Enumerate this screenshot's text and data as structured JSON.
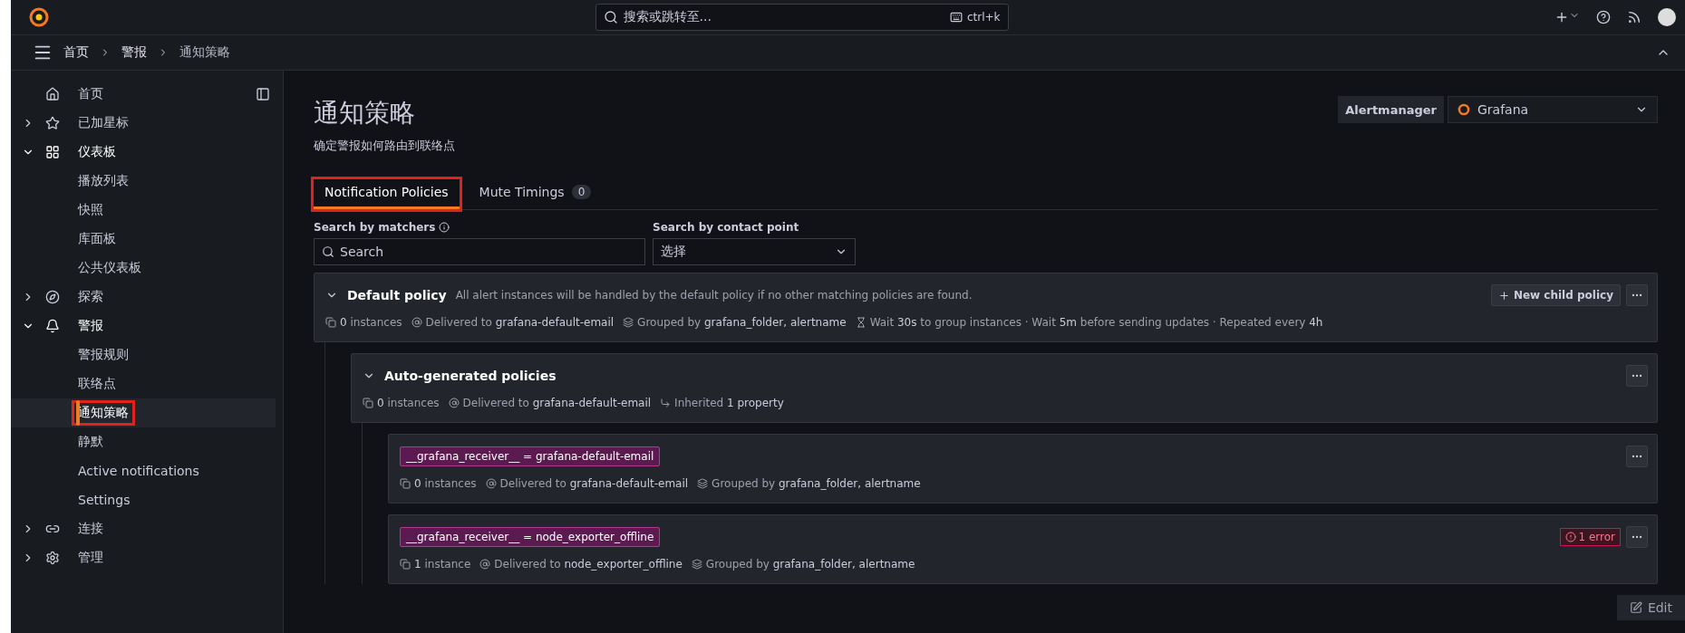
{
  "topbar": {
    "search_placeholder": "搜索或跳转至...",
    "shortcut": "ctrl+k"
  },
  "breadcrumbs": [
    {
      "label": "首页",
      "current": false
    },
    {
      "label": "警报",
      "current": false
    },
    {
      "label": "通知策略",
      "current": true
    }
  ],
  "sidebar": {
    "items": [
      {
        "label": "首页"
      },
      {
        "label": "已加星标",
        "expanded": false
      },
      {
        "label": "仪表板",
        "expanded": true,
        "children": [
          {
            "label": "播放列表",
            "selected": false,
            "marked": false
          },
          {
            "label": "快照",
            "selected": false,
            "marked": false
          },
          {
            "label": "库面板",
            "selected": false,
            "marked": false
          },
          {
            "label": "公共仪表板",
            "selected": false,
            "marked": false
          }
        ]
      },
      {
        "label": "探索",
        "expanded": false
      },
      {
        "label": "警报",
        "expanded": true,
        "children": [
          {
            "label": "警报规则",
            "selected": false,
            "marked": false
          },
          {
            "label": "联络点",
            "selected": false,
            "marked": false
          },
          {
            "label": "通知策略",
            "selected": true,
            "marked": true
          },
          {
            "label": "静默",
            "selected": false,
            "marked": false
          },
          {
            "label": "Active notifications",
            "selected": false,
            "marked": false
          },
          {
            "label": "Settings",
            "selected": false,
            "marked": false
          }
        ]
      },
      {
        "label": "连接",
        "expanded": false
      },
      {
        "label": "管理",
        "expanded": false
      }
    ]
  },
  "page": {
    "title": "通知策略",
    "subtitle": "确定警报如何路由到联络点",
    "alertmanager_label": "Alertmanager",
    "alertmanager_value": "Grafana"
  },
  "tabs": [
    {
      "label": "Notification Policies",
      "selected": true,
      "marked": true
    },
    {
      "label": "Mute Timings",
      "count": "0",
      "selected": false,
      "marked": false
    }
  ],
  "filters": {
    "matchers_label": "Search by matchers",
    "matchers_placeholder": "Search",
    "contact_label": "Search by contact point",
    "contact_value": "选择"
  },
  "policy": {
    "name": "Default policy",
    "description": "All alert instances will be handled by the default policy if no other matching policies are found.",
    "expanded": true,
    "button": "New child policy",
    "meta": [
      {
        "kind": "instances",
        "text": "**0** instances"
      },
      {
        "kind": "delivered",
        "text": "Delivered to **grafana-default-email**"
      },
      {
        "kind": "grouped",
        "text": "Grouped by **grafana_folder, alertname**"
      },
      {
        "kind": "timing",
        "text": "Wait **30s** to group instances · Wait **5m** before sending updates · Repeated every **4h**"
      }
    ],
    "children": [
      {
        "name": "Auto-generated policies",
        "expanded": true,
        "meta": [
          {
            "kind": "instances",
            "text": "**0** instances"
          },
          {
            "kind": "delivered",
            "text": "Delivered to **grafana-default-email**"
          },
          {
            "kind": "inherited",
            "text": "Inherited **1 property**"
          }
        ],
        "children": [
          {
            "matcher": "__grafana_receiver__ = grafana-default-email",
            "meta": [
              {
                "kind": "instances",
                "text": "**0** instances"
              },
              {
                "kind": "delivered",
                "text": "Delivered to **grafana-default-email**"
              },
              {
                "kind": "grouped",
                "text": "Grouped by **grafana_folder, alertname**"
              }
            ]
          },
          {
            "matcher": "__grafana_receiver__ = node_exporter_offline",
            "error": "1 error",
            "meta": [
              {
                "kind": "instances",
                "text": "**1** instance"
              },
              {
                "kind": "delivered",
                "text": "Delivered to **node_exporter_offline**"
              },
              {
                "kind": "grouped",
                "text": "Grouped by **grafana_folder, alertname**"
              }
            ]
          }
        ]
      }
    ]
  },
  "edit_button": "Edit"
}
